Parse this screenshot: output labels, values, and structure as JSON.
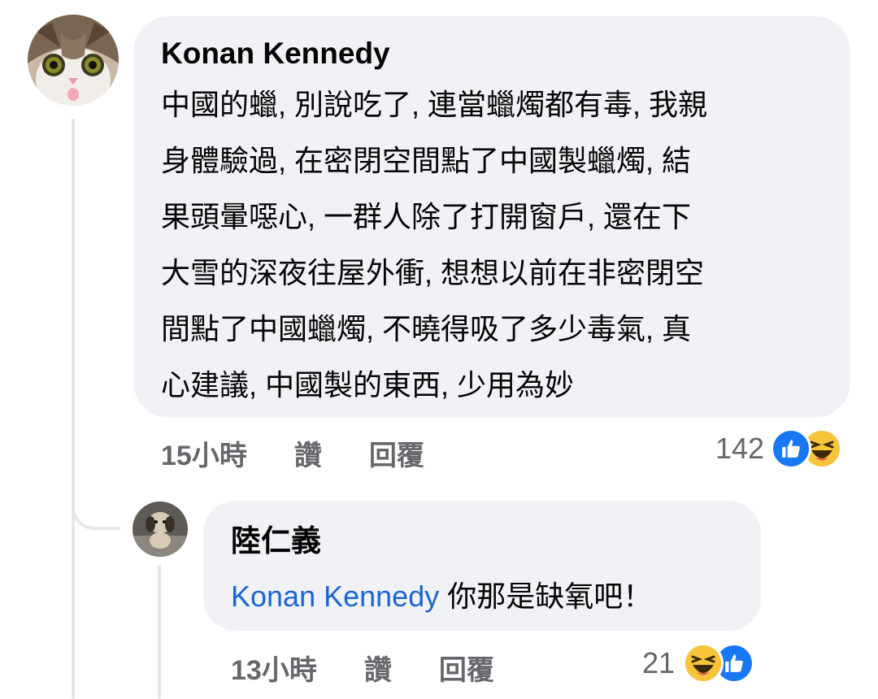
{
  "comment": {
    "author": "Konan Kennedy",
    "text": "中國的蠟, 別說吃了, 連當蠟燭都有毒, 我親\n身體驗過, 在密閉空間點了中國製蠟燭, 結\n果頭暈噁心, 一群人除了打開窗戶, 還在下\n大雪的深夜往屋外衝, 想想以前在非密閉空\n間點了中國蠟燭, 不曉得吸了多少毒氣, 真\n心建議, 中國製的東西, 少用為妙",
    "time": "15小時",
    "like_label": "讚",
    "reply_label": "回覆",
    "reaction_count": "142",
    "reactions": [
      "like-icon",
      "haha-icon"
    ],
    "avatar": "cat-avatar"
  },
  "reply": {
    "author": "陸仁義",
    "mention": "Konan Kennedy",
    "text": " 你那是缺氧吧！",
    "time": "13小時",
    "like_label": "讚",
    "reply_label": "回覆",
    "reaction_count": "21",
    "reactions": [
      "haha-icon",
      "like-icon"
    ],
    "avatar": "figurine-avatar"
  },
  "colors": {
    "bubble": "#f0f2f5",
    "mention": "#1c65d2",
    "meta": "#65676b",
    "like_blue": "#1877f2",
    "haha_yellow": "#f7c43a"
  }
}
